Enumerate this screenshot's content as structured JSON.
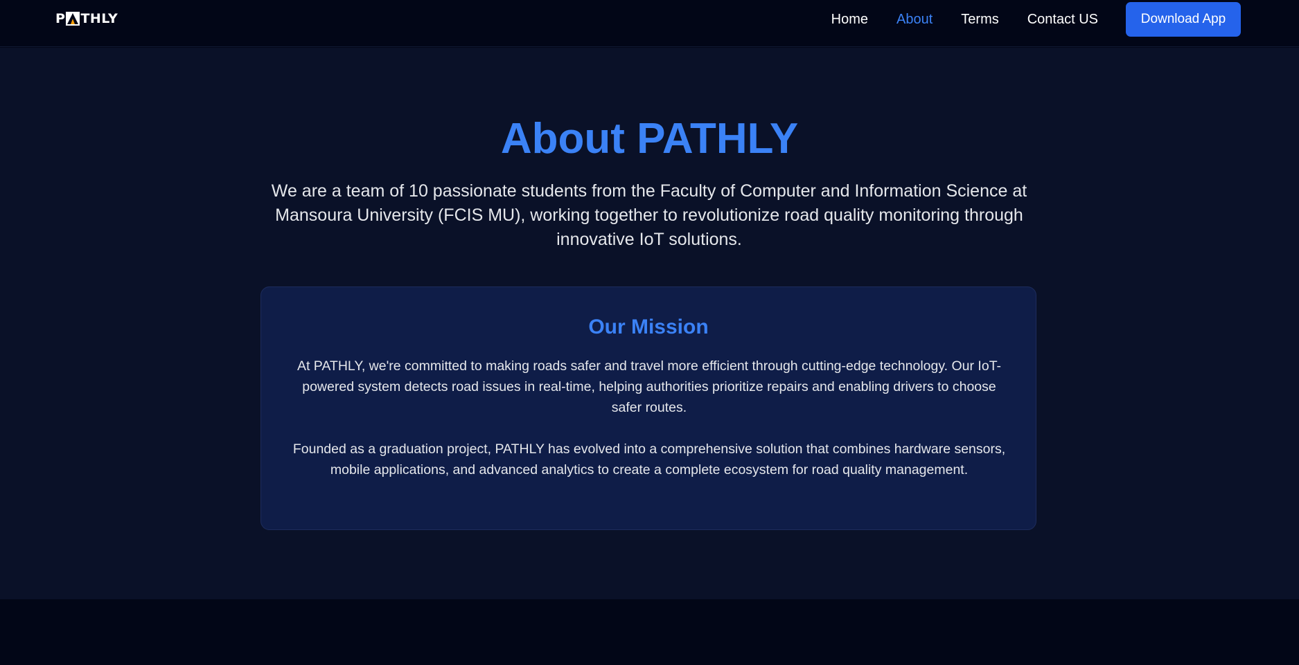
{
  "nav": {
    "logo_text_left": "P",
    "logo_text_right": "THLY",
    "links": [
      {
        "label": "Home"
      },
      {
        "label": "About"
      },
      {
        "label": "Terms"
      },
      {
        "label": "Contact US"
      }
    ],
    "active_link": "About",
    "cta_label": "Download App"
  },
  "hero": {
    "title": "About PATHLY",
    "intro": "We are a team of 10 passionate students from the Faculty of Computer and Information Science at Mansoura University (FCIS MU), working together to revolutionize road quality monitoring through innovative IoT solutions."
  },
  "mission": {
    "title": "Our Mission",
    "paragraph_1": "At PATHLY, we're committed to making roads safer and travel more efficient through cutting-edge technology. Our IoT-powered system detects road issues in real-time, helping authorities prioritize repairs and enabling drivers to choose safer routes.",
    "paragraph_2": "Founded as a graduation project, PATHLY has evolved into a comprehensive solution that combines hardware sensors, mobile applications, and advanced analytics to create a complete ecosystem for road quality management."
  },
  "colors": {
    "accent": "#3b82f6",
    "button": "#2563eb",
    "nav_bg": "#020617",
    "section_bg": "#0a1128",
    "card_bg": "#0f1d48",
    "logo_accent": "#f59e0b"
  },
  "icons": {
    "logo_mark": "road-triangle-icon"
  }
}
